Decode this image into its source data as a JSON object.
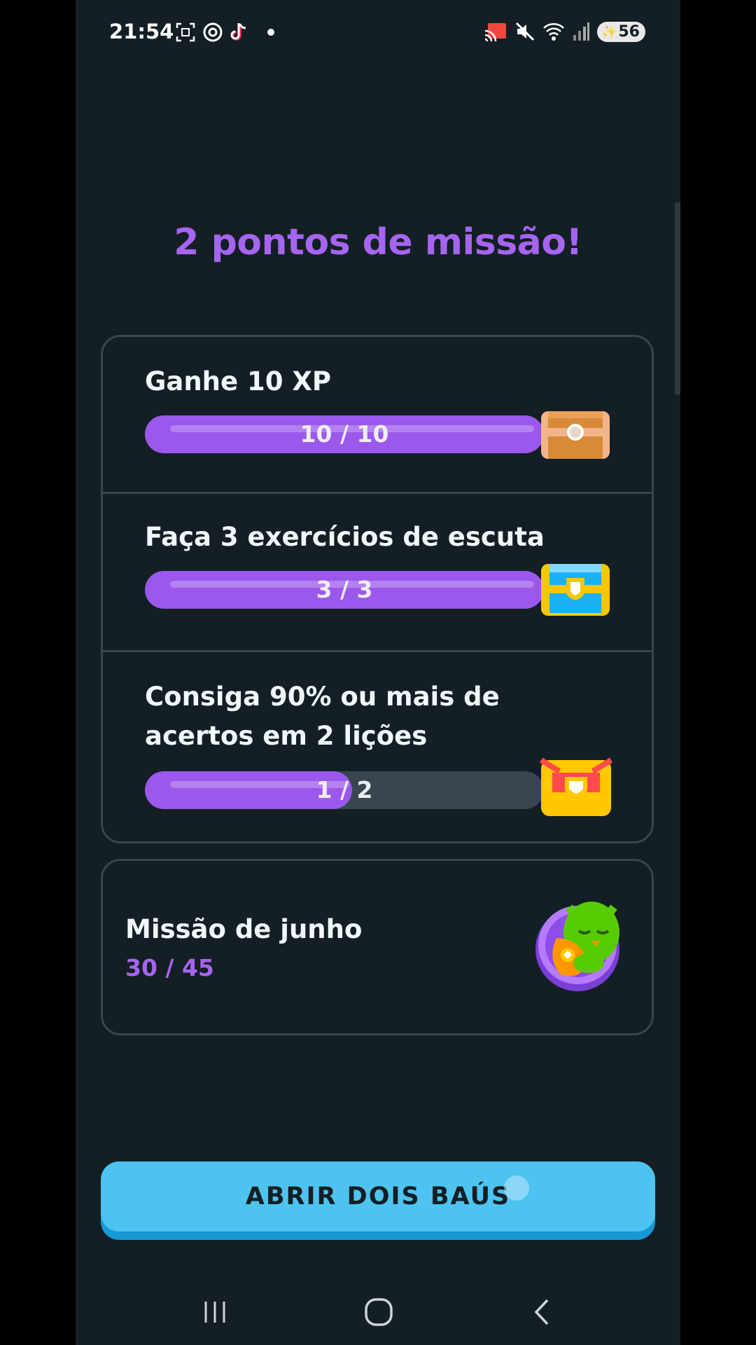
{
  "status_bar": {
    "time": "21:54",
    "battery": "56",
    "left_icons": [
      "screenshot-icon",
      "threads-icon",
      "tiktok-icon",
      "dot-icon"
    ],
    "right_icons": [
      "cast-icon",
      "mute-icon",
      "wifi-icon",
      "signal-icon",
      "battery-icon"
    ]
  },
  "headline": "2 pontos de missão!",
  "quests": [
    {
      "title": "Ganhe 10 XP",
      "progress_label": "10 / 10",
      "progress": 1.0,
      "chest": "bronze-chest-icon"
    },
    {
      "title": "Faça 3 exercícios de escuta",
      "progress_label": "3 / 3",
      "progress": 1.0,
      "chest": "silver-chest-icon"
    },
    {
      "title": "Consiga 90% ou mais de acertos em 2 lições",
      "progress_label": "1 / 2",
      "progress": 0.5,
      "chest": "gold-chest-icon"
    }
  ],
  "monthly": {
    "title": "Missão de junho",
    "progress_label": "30 / 45",
    "badge": "monthly-badge-icon"
  },
  "cta": {
    "label": "ABRIR DOIS BAÚS"
  },
  "nav": [
    "recents-icon",
    "home-icon",
    "back-icon"
  ],
  "colors": {
    "background": "#131f24",
    "accent_purple": "#a665f0",
    "progress_fill": "#9c57ec",
    "button": "#4fc3f0",
    "border": "#37464f"
  }
}
